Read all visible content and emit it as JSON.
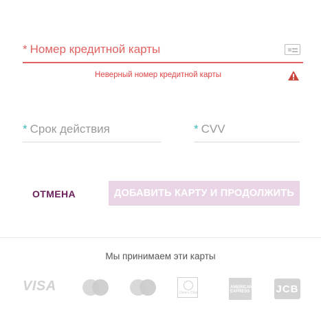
{
  "form": {
    "card_number": {
      "required_mark": "*",
      "label": "Номер кредитной карты",
      "icon": "credit-card-icon"
    },
    "error": {
      "message": "Неверный номер кредитной карты",
      "icon": "warning-icon",
      "color": "#e04545"
    },
    "expiry": {
      "required_mark": "*",
      "label": "Срок действия"
    },
    "cvv": {
      "required_mark": "*",
      "label": "CVV"
    }
  },
  "actions": {
    "cancel_label": "ОТМЕНА",
    "submit_label": "ДОБАВИТЬ КАРТУ И ПРОДОЛЖИТЬ"
  },
  "accepted": {
    "title": "Мы принимаем эти карты",
    "cards": [
      "visa",
      "mastercard",
      "maestro",
      "diners-club",
      "american-express",
      "jcb"
    ],
    "visa_text": "VISA",
    "diners_text": "Diners Club",
    "amex_text": "AMERICAN EXPRESS",
    "jcb_text": "JCB"
  },
  "colors": {
    "accent": "#6b1f5a",
    "button_disabled": "#ead5e6",
    "error": "#e26161",
    "required": "#3fb7b2"
  }
}
